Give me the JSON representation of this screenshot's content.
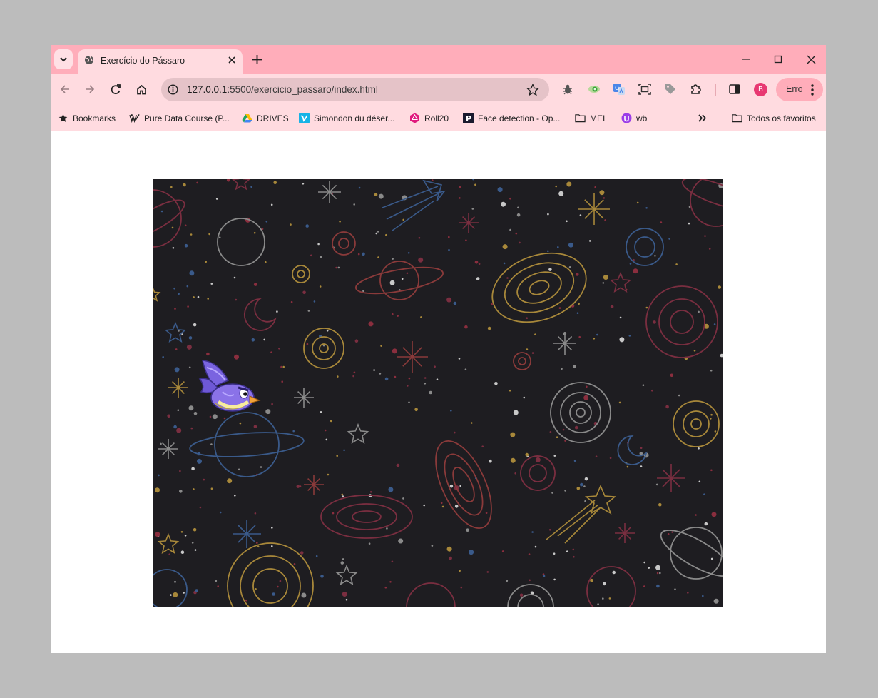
{
  "browser": {
    "tab": {
      "title": "Exercício do Pássaro"
    },
    "address": {
      "host": "127.0.0.1",
      "path": ":5500/exercicio_passaro/index.html"
    },
    "profile": {
      "initial": "B"
    },
    "error_button": {
      "label": "Erro"
    }
  },
  "bookmarks": {
    "items": [
      {
        "label": "Bookmarks",
        "icon": "star-icon"
      },
      {
        "label": "Pure Data Course (P...",
        "icon": "puredata-icon"
      },
      {
        "label": "DRIVES",
        "icon": "drive-icon"
      },
      {
        "label": "Simondon du déser...",
        "icon": "vimeo-icon"
      },
      {
        "label": "Roll20",
        "icon": "roll20-icon"
      },
      {
        "label": "Face detection - Op...",
        "icon": "p-icon"
      },
      {
        "label": "MEI",
        "icon": "folder-icon"
      },
      {
        "label": "wb",
        "icon": "wb-icon"
      }
    ],
    "all_bookmarks": "Todos os favoritos"
  },
  "game": {
    "background": "space-doodle-background",
    "sprite": "purple-bird",
    "colors": {
      "bg": "#1e1d21",
      "bird": "#8a72e8",
      "belly": "#f4e27a"
    }
  }
}
